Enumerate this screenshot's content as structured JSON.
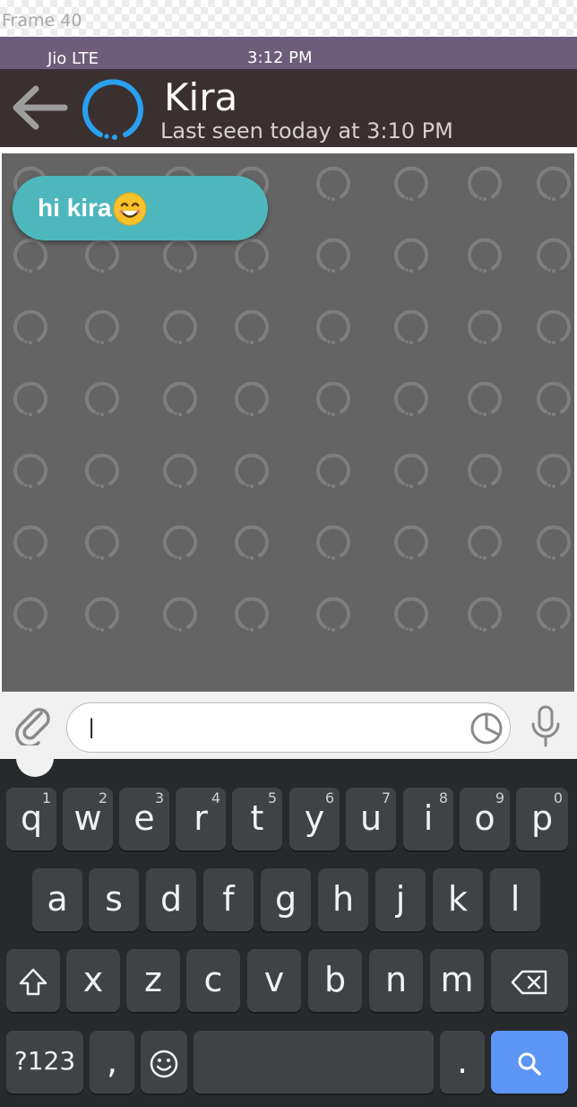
{
  "frame_label": "Frame 40",
  "status_bar": {
    "carrier": "Jio  LTE",
    "time": "3:12 PM"
  },
  "header": {
    "contact_name": "Kira",
    "last_seen": "Last seen today at 3:10 PM",
    "back_icon": "arrow-left-icon",
    "avatar_icon": "loading-ring-avatar"
  },
  "messages": [
    {
      "text": "hi kira",
      "emoji": "smiling-face-emoji"
    }
  ],
  "composer": {
    "input_value": "|",
    "attach_icon": "paperclip-icon",
    "sticker_icon": "sticker-icon",
    "mic_icon": "microphone-icon"
  },
  "keyboard": {
    "row1": [
      {
        "k": "q",
        "h": "1"
      },
      {
        "k": "w",
        "h": "2"
      },
      {
        "k": "e",
        "h": "3"
      },
      {
        "k": "r",
        "h": "4"
      },
      {
        "k": "t",
        "h": "5"
      },
      {
        "k": "y",
        "h": "6"
      },
      {
        "k": "u",
        "h": "7"
      },
      {
        "k": "i",
        "h": "8"
      },
      {
        "k": "o",
        "h": "9"
      },
      {
        "k": "p",
        "h": "0"
      }
    ],
    "row2": [
      "a",
      "s",
      "d",
      "f",
      "g",
      "h",
      "j",
      "k",
      "l"
    ],
    "row3": [
      "x",
      "z",
      "c",
      "v",
      "b",
      "n",
      "m"
    ],
    "symbols_key": "?123",
    "comma_key": ",",
    "period_key": "."
  },
  "colors": {
    "status_bar": "#6d5d7b",
    "header": "#3b3030",
    "chat_bg": "#646464",
    "bubble": "#4db7bd",
    "avatar_ring": "#2aa0f0",
    "keyboard_bg": "#262a2d",
    "search_key": "#5d95f5"
  }
}
